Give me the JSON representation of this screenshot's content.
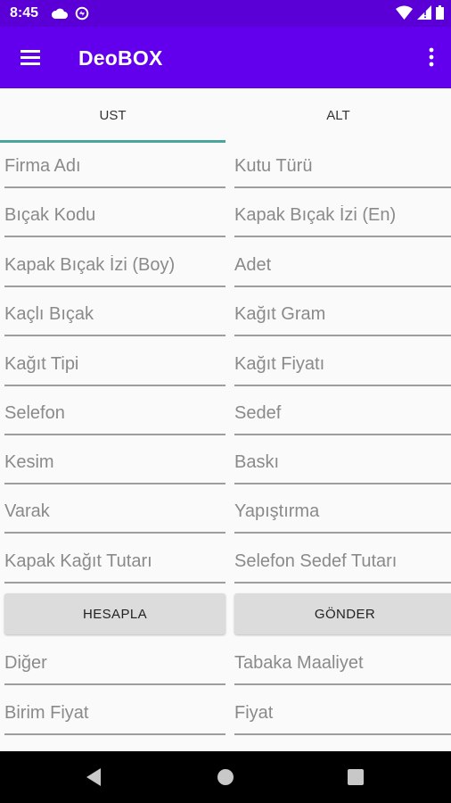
{
  "status_bar": {
    "time": "8:45"
  },
  "app_bar": {
    "title": "DeoBOX",
    "menu_icon": "hamburger-menu-icon",
    "more_icon": "more-vert-icon"
  },
  "tabs": [
    {
      "label": "UST",
      "selected": true
    },
    {
      "label": "ALT",
      "selected": false
    }
  ],
  "fields": {
    "firma_adi": "Firma Adı",
    "kutu_turu": "Kutu Türü",
    "bicak_kodu": "Bıçak Kodu",
    "kapak_bicak_izi_en": "Kapak Bıçak İzi (En)",
    "kapak_bicak_izi_boy": "Kapak Bıçak İzi (Boy)",
    "adet": "Adet",
    "kacli_bicak": "Kaçlı Bıçak",
    "kagit_gram": "Kağıt Gram",
    "kagit_tipi": "Kağıt Tipi",
    "kagit_fiyati": "Kağıt Fiyatı",
    "selefon": "Selefon",
    "sedef": "Sedef",
    "kesim": "Kesim",
    "baski": "Baskı",
    "varak": "Varak",
    "yapistirma": "Yapıştırma",
    "kapak_kagit_tutari": "Kapak Kağıt Tutarı",
    "selefon_sedef_tutari": "Selefon Sedef Tutarı",
    "diger": "Diğer",
    "tabaka_maaliyet": "Tabaka Maaliyet",
    "birim_fiyat": "Birim Fiyat",
    "fiyat": "Fiyat"
  },
  "buttons": {
    "hesapla": "HESAPLA",
    "gonder": "GÖNDER"
  },
  "colors": {
    "status_bar": "#5a00d6",
    "app_bar": "#6200ee",
    "tab_indicator": "#4aa59a",
    "button_bg": "#dcdcdc"
  }
}
